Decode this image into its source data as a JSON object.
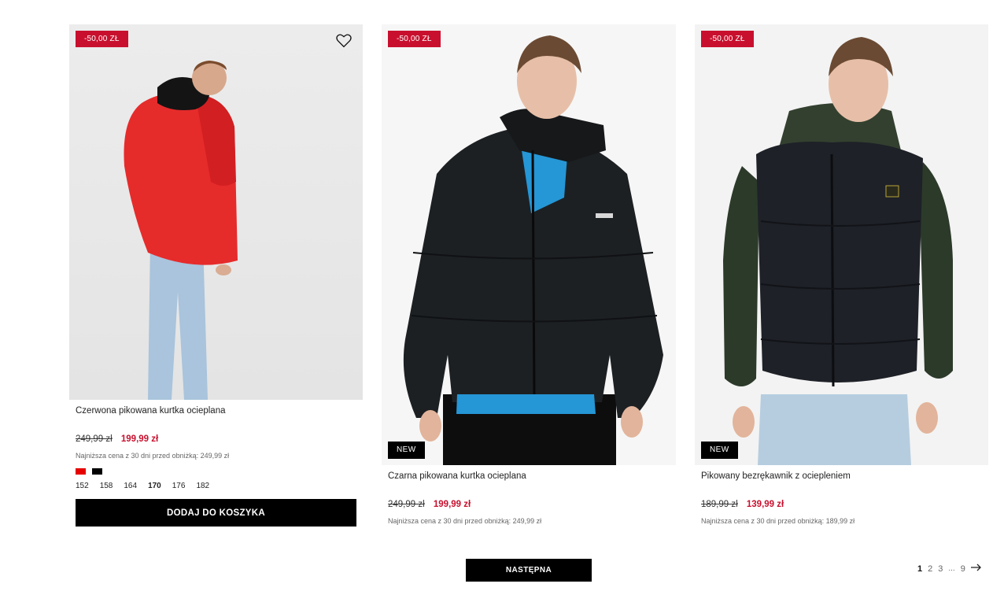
{
  "products": [
    {
      "discount": "-50,00 ZŁ",
      "name": "Czerwona pikowana kurtka ocieplana",
      "old_price": "249,99 zł",
      "price": "199,99 zł",
      "lowest_note": "Najniższa cena z 30 dni przed obniżką: 249,99 zł",
      "colors": [
        "#e60000",
        "#000000"
      ],
      "sizes": [
        "152",
        "158",
        "164",
        "170",
        "176",
        "182"
      ],
      "selected_size": "170",
      "add_to_cart_label": "DODAJ DO KOSZYKA",
      "wishlist_icon": "heart-icon"
    },
    {
      "discount": "-50,00 ZŁ",
      "new_badge": "NEW",
      "name": "Czarna pikowana kurtka ocieplana",
      "old_price": "249,99 zł",
      "price": "199,99 zł",
      "lowest_note": "Najniższa cena z 30 dni przed obniżką: 249,99 zł"
    },
    {
      "discount": "-50,00 ZŁ",
      "new_badge": "NEW",
      "name": "Pikowany bezrękawnik z ociepleniem",
      "old_price": "189,99 zł",
      "price": "139,99 zł",
      "lowest_note": "Najniższa cena z 30 dni przed obniżką: 189,99 zł"
    }
  ],
  "pagination": {
    "next_label": "NASTĘPNA",
    "pages": [
      "1",
      "2",
      "3"
    ],
    "ellipsis": "...",
    "last_page": "9",
    "current": "1",
    "next_icon": "arrow-right-icon"
  },
  "colors": {
    "sale": "#c8102e",
    "button": "#000000"
  }
}
